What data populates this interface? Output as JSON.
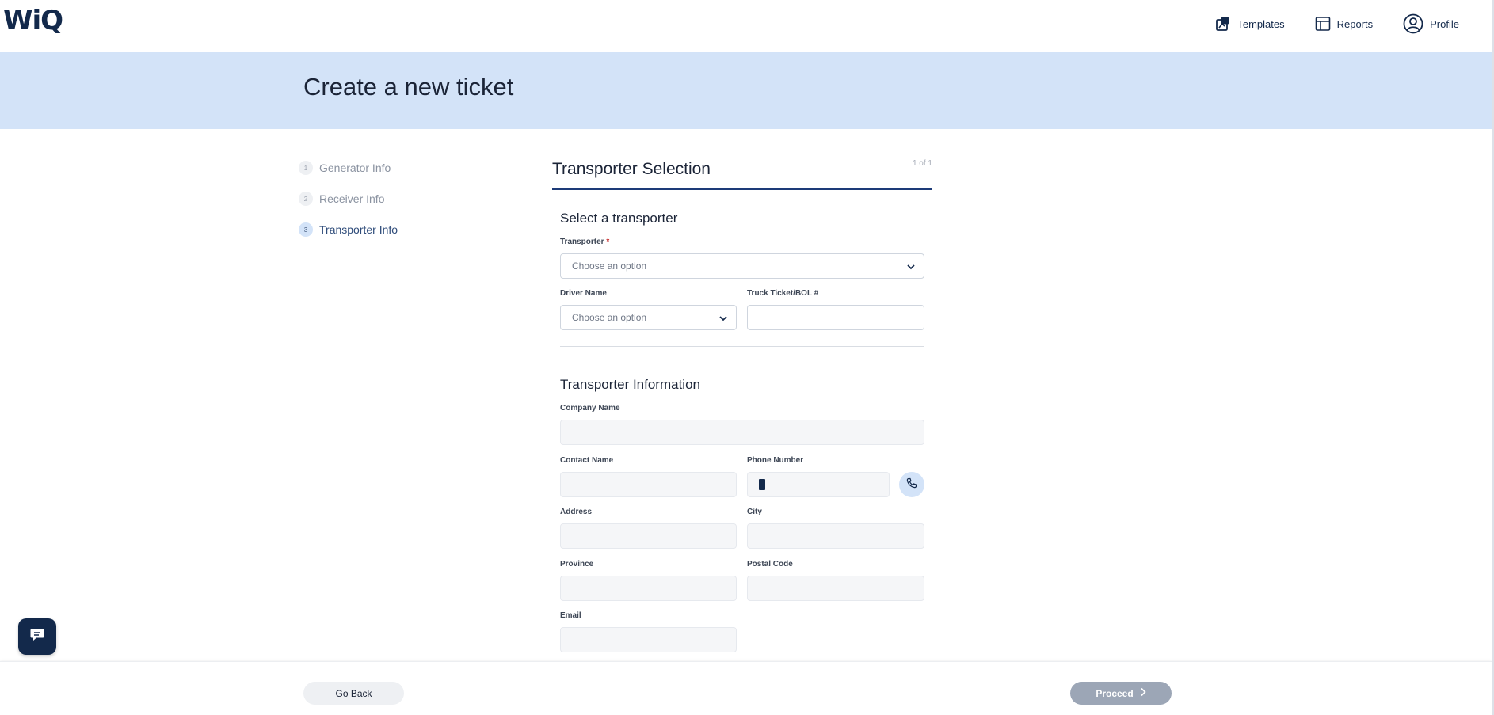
{
  "brand": {
    "logo_text": "WiQ",
    "color": "#13294b"
  },
  "nav": {
    "templates": {
      "label": "Templates",
      "icon": "templates-icon"
    },
    "reports": {
      "label": "Reports",
      "icon": "reports-icon"
    },
    "profile": {
      "label": "Profile",
      "icon": "profile-icon"
    }
  },
  "page": {
    "title": "Create a new ticket"
  },
  "steps": [
    {
      "number": "1",
      "label": "Generator Info",
      "state": "inactive"
    },
    {
      "number": "2",
      "label": "Receiver Info",
      "state": "inactive"
    },
    {
      "number": "3",
      "label": "Transporter Info",
      "state": "active"
    }
  ],
  "form": {
    "title": "Transporter Selection",
    "pager": "1 of 1",
    "selection": {
      "title": "Select a transporter",
      "transporter": {
        "label": "Transporter",
        "required_mark": "*",
        "placeholder": "Choose an option"
      },
      "driver": {
        "label": "Driver Name",
        "placeholder": "Choose an option"
      },
      "truck_ticket": {
        "label": "Truck Ticket/BOL #",
        "value": ""
      }
    },
    "info": {
      "title": "Transporter Information",
      "company_name": {
        "label": "Company Name",
        "value": ""
      },
      "contact_name": {
        "label": "Contact Name",
        "value": ""
      },
      "phone_number": {
        "label": "Phone Number",
        "value": ""
      },
      "address": {
        "label": "Address",
        "value": ""
      },
      "city": {
        "label": "City",
        "value": ""
      },
      "province": {
        "label": "Province",
        "value": ""
      },
      "postal_code": {
        "label": "Postal Code",
        "value": ""
      },
      "email": {
        "label": "Email",
        "value": ""
      }
    }
  },
  "footer": {
    "back_label": "Go Back",
    "proceed_label": "Proceed",
    "proceed_state": "disabled"
  },
  "colors": {
    "banner": "#d3e3f8",
    "accent": "#1d3b78",
    "proceed_disabled": "#9ca6b6"
  },
  "chat": {
    "icon": "chat-icon"
  }
}
